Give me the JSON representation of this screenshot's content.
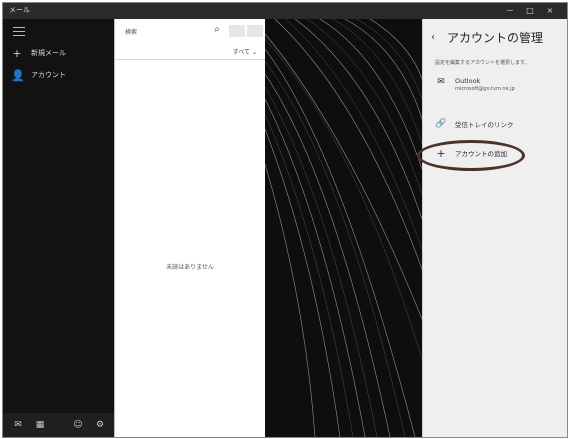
{
  "window": {
    "title": "メール",
    "controls": {
      "minimize": "－",
      "maximize": "□",
      "close": "×"
    }
  },
  "sidebar": {
    "hamburger_icon": "hamburger-icon",
    "items": [
      {
        "icon": "+",
        "label": "新規メール"
      },
      {
        "icon": "👤",
        "label": "アカウント"
      }
    ],
    "bottom_icons": [
      {
        "name": "mail-icon",
        "glyph": "✉"
      },
      {
        "name": "calendar-icon",
        "glyph": "▦"
      },
      {
        "name": "people-icon",
        "glyph": "☺"
      },
      {
        "name": "settings-icon",
        "glyph": "⚙"
      }
    ]
  },
  "list": {
    "search_placeholder": "検索",
    "search_icon": "⌕",
    "filter_label": "すべて ⌄",
    "empty_text": "未読はありません"
  },
  "account_panel": {
    "back_icon": "‹",
    "title": "アカウントの管理",
    "subtitle": "設定を編集するアカウントを選択します。",
    "accounts": [
      {
        "icon": "✉",
        "name": "Outlook",
        "email": "microsoft@go.tvm.ne.jp"
      }
    ],
    "link_inboxes_label": "受信トレイのリンク",
    "link_inboxes_icon": "🔗",
    "add_account_icon": "+",
    "add_account_label": "アカウントの追加"
  },
  "colors": {
    "sidebar_bg": "#121212",
    "pane_bg": "#ffffff",
    "account_bg": "#efefef",
    "highlight_ring": "#4b3328"
  }
}
